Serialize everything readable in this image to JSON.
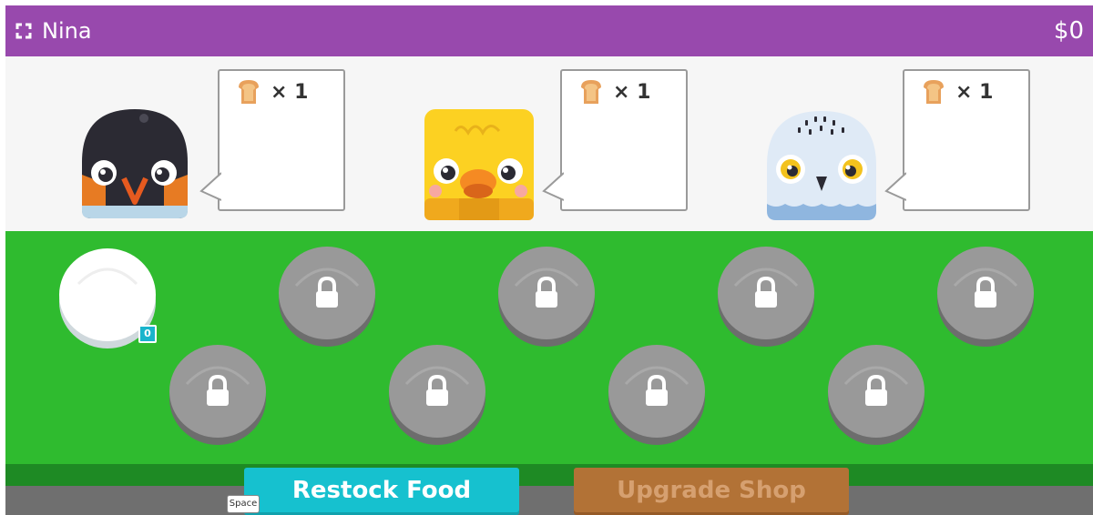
{
  "header": {
    "player_name": "Nina",
    "money": "$0",
    "fullscreen_icon": "fullscreen-icon",
    "bar_color": "#9849ad"
  },
  "customers": [
    {
      "name": "penguin",
      "order_item": "toast-icon",
      "order_count": "× 1"
    },
    {
      "name": "chick",
      "order_item": "toast-icon",
      "order_count": "× 1"
    },
    {
      "name": "owl",
      "order_item": "toast-icon",
      "order_count": "× 1"
    }
  ],
  "plates": {
    "active_count": "0",
    "locked_icon": "lock-icon",
    "total_slots": 9,
    "unlocked_slots": 1
  },
  "buttons": {
    "restock_label": "Restock Food",
    "restock_hotkey": "Space",
    "upgrade_label": "Upgrade Shop"
  },
  "colors": {
    "counter": "#2fbb2f",
    "restock": "#16c1cf",
    "upgrade": "#b27236",
    "badge": "#19b4cc"
  }
}
